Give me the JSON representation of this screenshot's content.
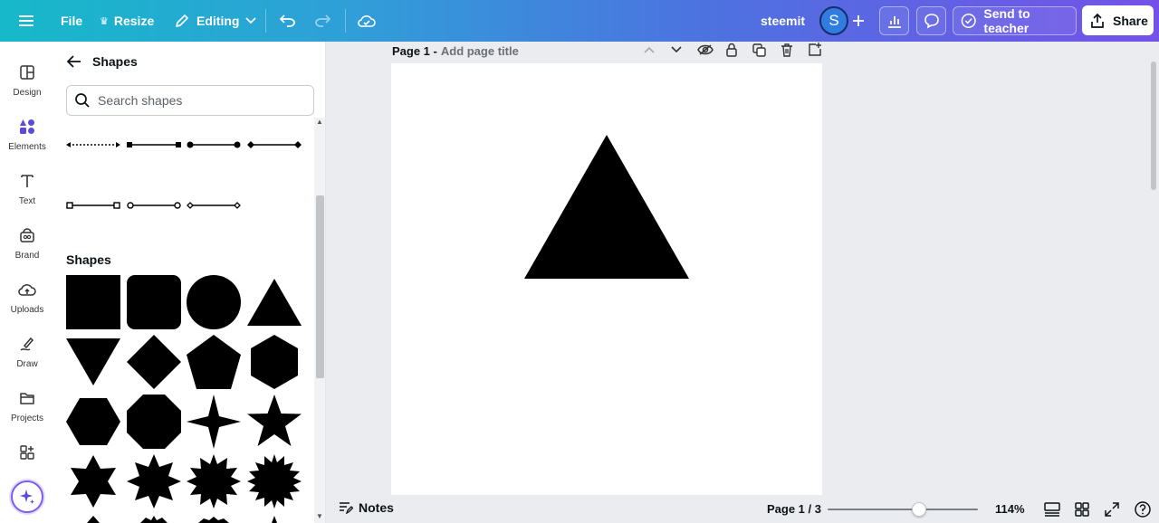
{
  "topbar": {
    "menu_icon": "hamburger-icon",
    "file_label": "File",
    "resize_label": "Resize",
    "editing_label": "Editing",
    "project_name": "steemit",
    "avatar_initial": "S",
    "send_label": "Send to teacher",
    "share_label": "Share"
  },
  "rail": {
    "items": [
      {
        "label": "Design",
        "icon": "layout-icon"
      },
      {
        "label": "Elements",
        "icon": "elements-icon"
      },
      {
        "label": "Text",
        "icon": "text-icon"
      },
      {
        "label": "Brand",
        "icon": "brand-icon"
      },
      {
        "label": "Uploads",
        "icon": "upload-cloud-icon"
      },
      {
        "label": "Draw",
        "icon": "pen-icon"
      },
      {
        "label": "Projects",
        "icon": "folder-icon"
      },
      {
        "label": "",
        "icon": "apps-icon"
      }
    ],
    "active": "Elements"
  },
  "panel": {
    "title": "Shapes",
    "search_placeholder": "Search shapes",
    "section_label": "Shapes"
  },
  "canvas": {
    "page_label": "Page 1 -",
    "page_title_placeholder": "Add page title",
    "element": "triangle"
  },
  "bottombar": {
    "notes_label": "Notes",
    "page_count": "Page 1 / 3",
    "zoom": "114%",
    "zoom_fraction": 0.61
  },
  "colors": {
    "topbar_gradient_start": "#16b9c9",
    "topbar_gradient_end": "#7451e8",
    "accent": "#7a5cf0",
    "shape_fill": "#000000"
  }
}
